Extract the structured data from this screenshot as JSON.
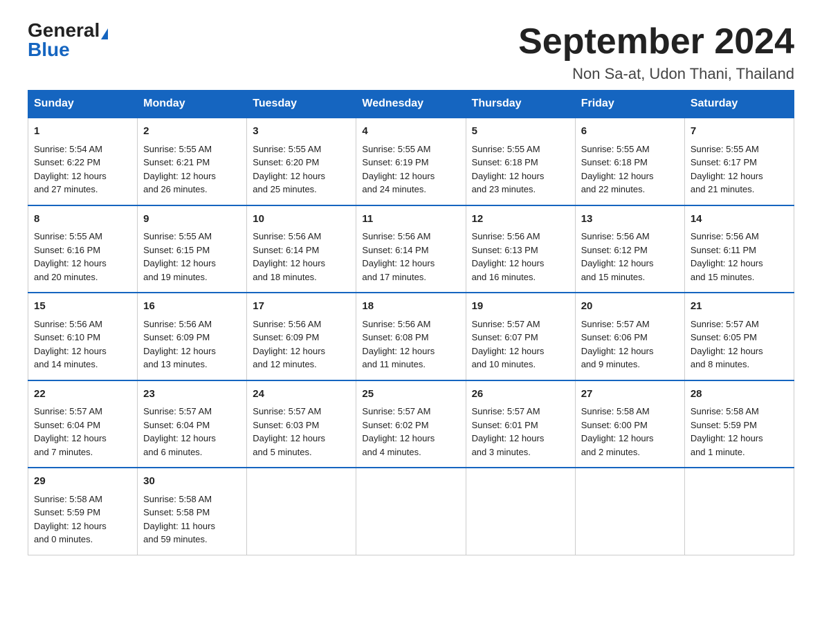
{
  "logo": {
    "general": "General",
    "blue": "Blue"
  },
  "title": "September 2024",
  "subtitle": "Non Sa-at, Udon Thani, Thailand",
  "headers": [
    "Sunday",
    "Monday",
    "Tuesday",
    "Wednesday",
    "Thursday",
    "Friday",
    "Saturday"
  ],
  "weeks": [
    [
      {
        "day": "1",
        "info": "Sunrise: 5:54 AM\nSunset: 6:22 PM\nDaylight: 12 hours\nand 27 minutes."
      },
      {
        "day": "2",
        "info": "Sunrise: 5:55 AM\nSunset: 6:21 PM\nDaylight: 12 hours\nand 26 minutes."
      },
      {
        "day": "3",
        "info": "Sunrise: 5:55 AM\nSunset: 6:20 PM\nDaylight: 12 hours\nand 25 minutes."
      },
      {
        "day": "4",
        "info": "Sunrise: 5:55 AM\nSunset: 6:19 PM\nDaylight: 12 hours\nand 24 minutes."
      },
      {
        "day": "5",
        "info": "Sunrise: 5:55 AM\nSunset: 6:18 PM\nDaylight: 12 hours\nand 23 minutes."
      },
      {
        "day": "6",
        "info": "Sunrise: 5:55 AM\nSunset: 6:18 PM\nDaylight: 12 hours\nand 22 minutes."
      },
      {
        "day": "7",
        "info": "Sunrise: 5:55 AM\nSunset: 6:17 PM\nDaylight: 12 hours\nand 21 minutes."
      }
    ],
    [
      {
        "day": "8",
        "info": "Sunrise: 5:55 AM\nSunset: 6:16 PM\nDaylight: 12 hours\nand 20 minutes."
      },
      {
        "day": "9",
        "info": "Sunrise: 5:55 AM\nSunset: 6:15 PM\nDaylight: 12 hours\nand 19 minutes."
      },
      {
        "day": "10",
        "info": "Sunrise: 5:56 AM\nSunset: 6:14 PM\nDaylight: 12 hours\nand 18 minutes."
      },
      {
        "day": "11",
        "info": "Sunrise: 5:56 AM\nSunset: 6:14 PM\nDaylight: 12 hours\nand 17 minutes."
      },
      {
        "day": "12",
        "info": "Sunrise: 5:56 AM\nSunset: 6:13 PM\nDaylight: 12 hours\nand 16 minutes."
      },
      {
        "day": "13",
        "info": "Sunrise: 5:56 AM\nSunset: 6:12 PM\nDaylight: 12 hours\nand 15 minutes."
      },
      {
        "day": "14",
        "info": "Sunrise: 5:56 AM\nSunset: 6:11 PM\nDaylight: 12 hours\nand 15 minutes."
      }
    ],
    [
      {
        "day": "15",
        "info": "Sunrise: 5:56 AM\nSunset: 6:10 PM\nDaylight: 12 hours\nand 14 minutes."
      },
      {
        "day": "16",
        "info": "Sunrise: 5:56 AM\nSunset: 6:09 PM\nDaylight: 12 hours\nand 13 minutes."
      },
      {
        "day": "17",
        "info": "Sunrise: 5:56 AM\nSunset: 6:09 PM\nDaylight: 12 hours\nand 12 minutes."
      },
      {
        "day": "18",
        "info": "Sunrise: 5:56 AM\nSunset: 6:08 PM\nDaylight: 12 hours\nand 11 minutes."
      },
      {
        "day": "19",
        "info": "Sunrise: 5:57 AM\nSunset: 6:07 PM\nDaylight: 12 hours\nand 10 minutes."
      },
      {
        "day": "20",
        "info": "Sunrise: 5:57 AM\nSunset: 6:06 PM\nDaylight: 12 hours\nand 9 minutes."
      },
      {
        "day": "21",
        "info": "Sunrise: 5:57 AM\nSunset: 6:05 PM\nDaylight: 12 hours\nand 8 minutes."
      }
    ],
    [
      {
        "day": "22",
        "info": "Sunrise: 5:57 AM\nSunset: 6:04 PM\nDaylight: 12 hours\nand 7 minutes."
      },
      {
        "day": "23",
        "info": "Sunrise: 5:57 AM\nSunset: 6:04 PM\nDaylight: 12 hours\nand 6 minutes."
      },
      {
        "day": "24",
        "info": "Sunrise: 5:57 AM\nSunset: 6:03 PM\nDaylight: 12 hours\nand 5 minutes."
      },
      {
        "day": "25",
        "info": "Sunrise: 5:57 AM\nSunset: 6:02 PM\nDaylight: 12 hours\nand 4 minutes."
      },
      {
        "day": "26",
        "info": "Sunrise: 5:57 AM\nSunset: 6:01 PM\nDaylight: 12 hours\nand 3 minutes."
      },
      {
        "day": "27",
        "info": "Sunrise: 5:58 AM\nSunset: 6:00 PM\nDaylight: 12 hours\nand 2 minutes."
      },
      {
        "day": "28",
        "info": "Sunrise: 5:58 AM\nSunset: 5:59 PM\nDaylight: 12 hours\nand 1 minute."
      }
    ],
    [
      {
        "day": "29",
        "info": "Sunrise: 5:58 AM\nSunset: 5:59 PM\nDaylight: 12 hours\nand 0 minutes."
      },
      {
        "day": "30",
        "info": "Sunrise: 5:58 AM\nSunset: 5:58 PM\nDaylight: 11 hours\nand 59 minutes."
      },
      {
        "day": "",
        "info": ""
      },
      {
        "day": "",
        "info": ""
      },
      {
        "day": "",
        "info": ""
      },
      {
        "day": "",
        "info": ""
      },
      {
        "day": "",
        "info": ""
      }
    ]
  ]
}
